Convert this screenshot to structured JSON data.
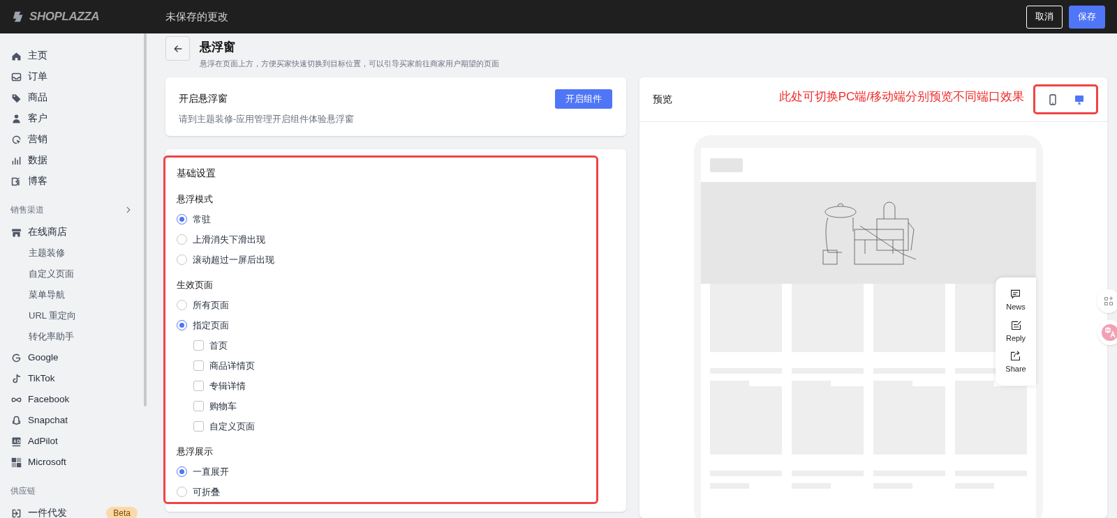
{
  "top_bar": {
    "logo": "SHOPLAZZA",
    "status": "未保存的更改",
    "buttons": [
      {
        "label": "取消",
        "kind": "secondary"
      },
      {
        "label": "保存",
        "kind": "primary"
      }
    ]
  },
  "sidebar": {
    "items": [
      {
        "label": "主页",
        "kind": "nav"
      },
      {
        "label": "订单",
        "kind": "nav"
      },
      {
        "label": "商品",
        "kind": "nav"
      },
      {
        "label": "客户",
        "kind": "nav"
      },
      {
        "label": "营销",
        "kind": "nav"
      },
      {
        "label": "数据",
        "kind": "nav"
      },
      {
        "label": "博客",
        "kind": "nav"
      },
      {
        "label": "销售渠道",
        "kind": "section",
        "expandable": true
      },
      {
        "label": "在线商店",
        "kind": "nav"
      },
      {
        "label": "主题装修",
        "kind": "sub"
      },
      {
        "label": "自定义页面",
        "kind": "sub"
      },
      {
        "label": "菜单导航",
        "kind": "sub"
      },
      {
        "label": "URL 重定向",
        "kind": "sub"
      },
      {
        "label": "转化率助手",
        "kind": "sub"
      },
      {
        "label": "Google",
        "kind": "nav"
      },
      {
        "label": "TikTok",
        "kind": "nav"
      },
      {
        "label": "Facebook",
        "kind": "nav"
      },
      {
        "label": "Snapchat",
        "kind": "nav"
      },
      {
        "label": "AdPilot",
        "kind": "nav"
      },
      {
        "label": "Microsoft",
        "kind": "nav"
      },
      {
        "label": "供应链",
        "kind": "section",
        "expandable": false
      },
      {
        "label": "一件代发",
        "kind": "nav",
        "badge": "Beta"
      }
    ]
  },
  "page_header": {
    "title": "悬浮窗",
    "subtitle": "悬浮在页面上方，方便买家快速切换到目标位置，可以引导买家前往商家用户期望的页面"
  },
  "enable_card": {
    "title": "开启悬浮窗",
    "description": "请到主题装修-应用管理开启组件体验悬浮窗",
    "button": "开启组件"
  },
  "settings": {
    "title": "基础设置",
    "groups": [
      {
        "label": "悬浮模式",
        "options": [
          {
            "label": "常驻",
            "selected": true
          },
          {
            "label": "上滑消失下滑出现",
            "selected": false
          },
          {
            "label": "滚动超过一屏后出现",
            "selected": false
          }
        ]
      },
      {
        "label": "生效页面",
        "options": [
          {
            "label": "所有页面",
            "selected": false
          },
          {
            "label": "指定页面",
            "selected": true,
            "children": [
              {
                "label": "首页",
                "checked": false
              },
              {
                "label": "商品详情页",
                "checked": false
              },
              {
                "label": "专辑详情",
                "checked": false
              },
              {
                "label": "购物车",
                "checked": false
              },
              {
                "label": "自定义页面",
                "checked": false
              }
            ]
          }
        ]
      },
      {
        "label": "悬浮展示",
        "options": [
          {
            "label": "一直展开",
            "selected": true
          },
          {
            "label": "可折叠",
            "selected": false
          }
        ]
      }
    ]
  },
  "preview": {
    "title": "预览",
    "annotation": "此处可切换PC端/移动端分别预览不同端口效果",
    "devices": [
      {
        "kind": "mobile",
        "selected": false
      },
      {
        "kind": "desktop",
        "selected": true
      }
    ],
    "float_widget": [
      {
        "label": "News"
      },
      {
        "label": "Reply"
      },
      {
        "label": "Share"
      }
    ]
  }
}
